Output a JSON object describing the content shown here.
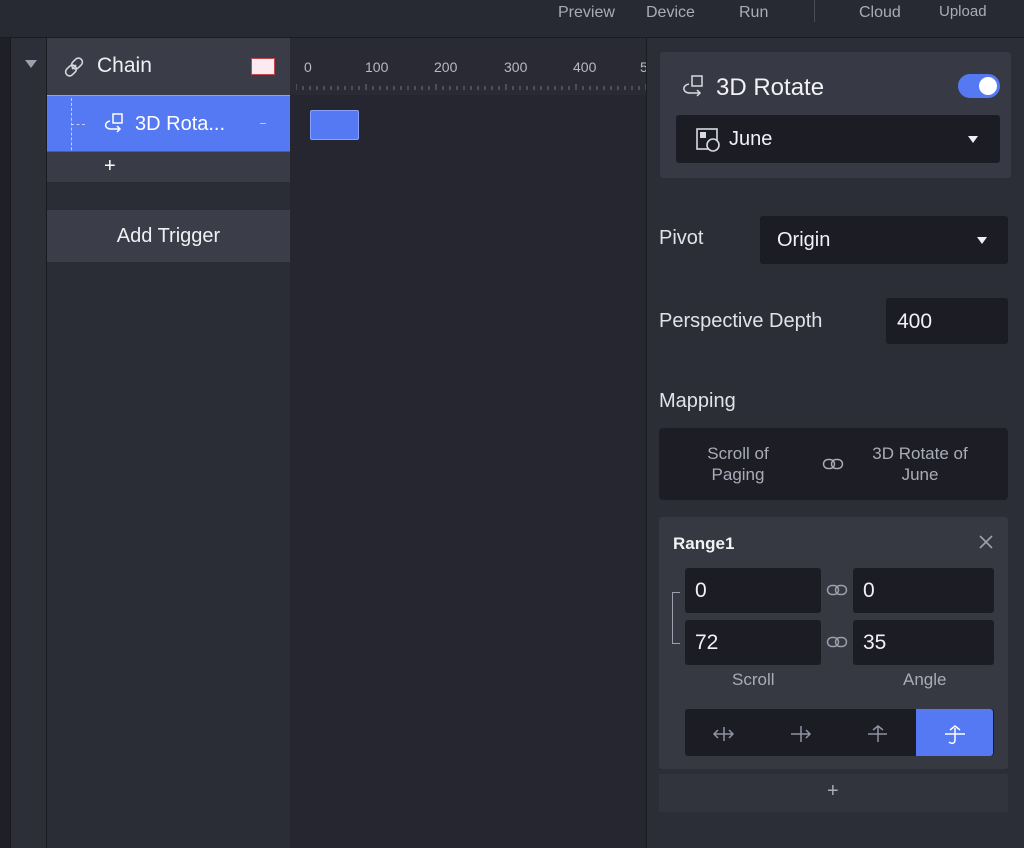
{
  "topbar": {
    "items": [
      "Preview",
      "Device",
      "Run",
      "Cloud",
      "Upload"
    ]
  },
  "layers": {
    "chain_label": "Chain",
    "rotate_label": "3D Rota...",
    "add_symbol": "+",
    "add_trigger_label": "Add Trigger"
  },
  "timeline": {
    "ticks": [
      "0",
      "100",
      "200",
      "300",
      "400",
      "5"
    ]
  },
  "inspector": {
    "title": "3D Rotate",
    "enabled": true,
    "target": "June",
    "pivot_label": "Pivot",
    "pivot_value": "Origin",
    "perspective_label": "Perspective Depth",
    "perspective_value": "400",
    "mapping_label": "Mapping",
    "mapping_left_line1": "Scroll of",
    "mapping_left_line2": "Paging",
    "mapping_right_line1": "3D Rotate of",
    "mapping_right_line2": "June",
    "range": {
      "title": "Range1",
      "scroll_from": "0",
      "scroll_to": "72",
      "angle_from": "0",
      "angle_to": "35",
      "scroll_label": "Scroll",
      "angle_label": "Angle",
      "selected_curve_index": 3
    },
    "add_range_symbol": "+"
  },
  "colors": {
    "accent": "#5579f3",
    "panel": "#2b2d37",
    "field": "#1c1d24"
  }
}
